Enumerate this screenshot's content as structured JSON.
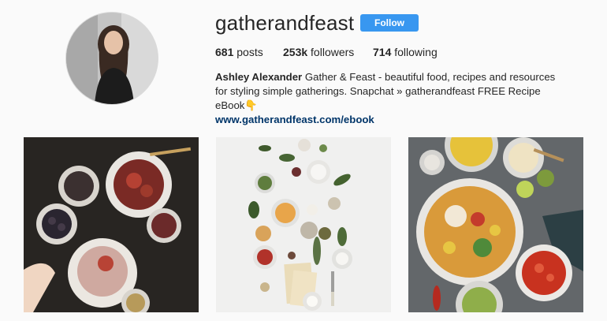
{
  "profile": {
    "username": "gatherandfeast",
    "follow_label": "Follow",
    "stats": {
      "posts_count": "681",
      "posts_label": "posts",
      "followers_count": "253k",
      "followers_label": "followers",
      "following_count": "714",
      "following_label": "following"
    },
    "bio": {
      "name": "Ashley Alexander",
      "text": " Gather & Feast - beautiful food, recipes and resources for styling simple gatherings. Snapchat » gatherandfeast FREE Recipe eBook👇",
      "link": "www.gatherandfeast.com/ebook"
    }
  },
  "colors": {
    "follow_button": "#3897f0",
    "link": "#003569",
    "background": "#fafafa"
  }
}
